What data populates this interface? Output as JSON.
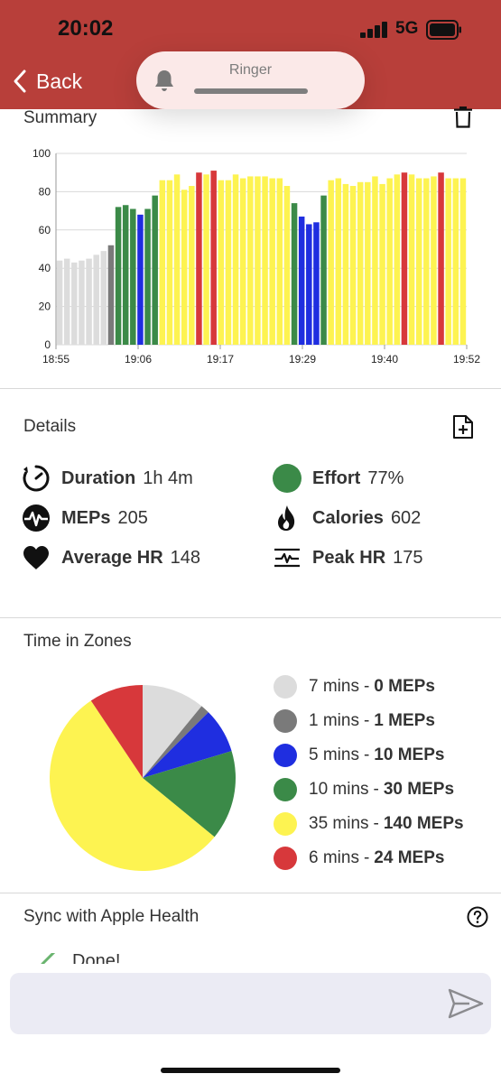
{
  "status_bar": {
    "time": "20:02",
    "network": "5G"
  },
  "nav": {
    "back_label": "Back"
  },
  "ringer": {
    "label": "Ringer"
  },
  "summary": {
    "title": "Summary",
    "icon": "trash-icon"
  },
  "chart_data": {
    "type": "bar",
    "title": "",
    "xlabel": "",
    "ylabel": "",
    "ylim": [
      0,
      100
    ],
    "yticks": [
      0,
      20,
      40,
      60,
      80,
      100
    ],
    "xtick_labels": [
      "18:55",
      "19:06",
      "19:17",
      "19:29",
      "19:40",
      "19:52"
    ],
    "values": [
      44,
      45,
      43,
      44,
      45,
      47,
      49,
      52,
      72,
      73,
      71,
      68,
      71,
      78,
      86,
      86,
      89,
      81,
      83,
      90,
      89,
      91,
      86,
      86,
      89,
      87,
      88,
      88,
      88,
      87,
      87,
      83,
      74,
      67,
      63,
      64,
      78,
      86,
      87,
      84,
      83,
      85,
      85,
      88,
      84,
      87,
      89,
      90,
      89,
      87,
      87,
      88,
      90,
      87,
      87,
      87
    ],
    "zones": [
      0,
      0,
      0,
      0,
      0,
      0,
      0,
      1,
      3,
      3,
      3,
      2,
      3,
      3,
      4,
      4,
      4,
      4,
      4,
      5,
      4,
      5,
      4,
      4,
      4,
      4,
      4,
      4,
      4,
      4,
      4,
      4,
      3,
      2,
      2,
      2,
      3,
      4,
      4,
      4,
      4,
      4,
      4,
      4,
      4,
      4,
      4,
      5,
      4,
      4,
      4,
      4,
      5,
      4,
      4,
      4
    ],
    "zone_colors": [
      "#dcdcdc",
      "#7a7a7a",
      "#1f2ee0",
      "#3b8a48",
      "#fdf351",
      "#d7383b"
    ],
    "grid": true
  },
  "details": {
    "title": "Details",
    "icon": "add-file-icon",
    "stats": [
      {
        "name": "Duration",
        "value": "1h 4m",
        "icon": "timer-icon"
      },
      {
        "name": "Effort",
        "value": "77%",
        "icon": "effort-dot-icon",
        "color": "#3b8a48"
      },
      {
        "name": "MEPs",
        "value": "205",
        "icon": "meps-pulse-icon"
      },
      {
        "name": "Calories",
        "value": "602",
        "icon": "flame-icon"
      },
      {
        "name": "Average HR",
        "value": "148",
        "icon": "heart-icon"
      },
      {
        "name": "Peak HR",
        "value": "175",
        "icon": "peak-hr-icon"
      }
    ]
  },
  "zones": {
    "title": "Time in Zones",
    "pie": [
      {
        "minutes": 7,
        "color": "#dcdcdc"
      },
      {
        "minutes": 1,
        "color": "#7a7a7a"
      },
      {
        "minutes": 5,
        "color": "#1f2ee0"
      },
      {
        "minutes": 10,
        "color": "#3b8a48"
      },
      {
        "minutes": 35,
        "color": "#fdf351"
      },
      {
        "minutes": 6,
        "color": "#d7383b"
      }
    ],
    "legend": [
      {
        "mins": "7 mins",
        "sep": "-",
        "meps": "0 MEPs",
        "color": "#dcdcdc"
      },
      {
        "mins": "1 mins",
        "sep": "-",
        "meps": "1 MEPs",
        "color": "#7a7a7a"
      },
      {
        "mins": "5 mins",
        "sep": "-",
        "meps": "10 MEPs",
        "color": "#1f2ee0"
      },
      {
        "mins": "10 mins",
        "sep": "-",
        "meps": "30 MEPs",
        "color": "#3b8a48"
      },
      {
        "mins": "35 mins",
        "sep": "-",
        "meps": "140 MEPs",
        "color": "#fdf351"
      },
      {
        "mins": "6 mins",
        "sep": "-",
        "meps": "24 MEPs",
        "color": "#d7383b"
      }
    ]
  },
  "sync": {
    "title": "Sync with Apple Health",
    "status": "Done!",
    "icon": "help-icon"
  },
  "composer": {
    "icon": "send-icon"
  }
}
